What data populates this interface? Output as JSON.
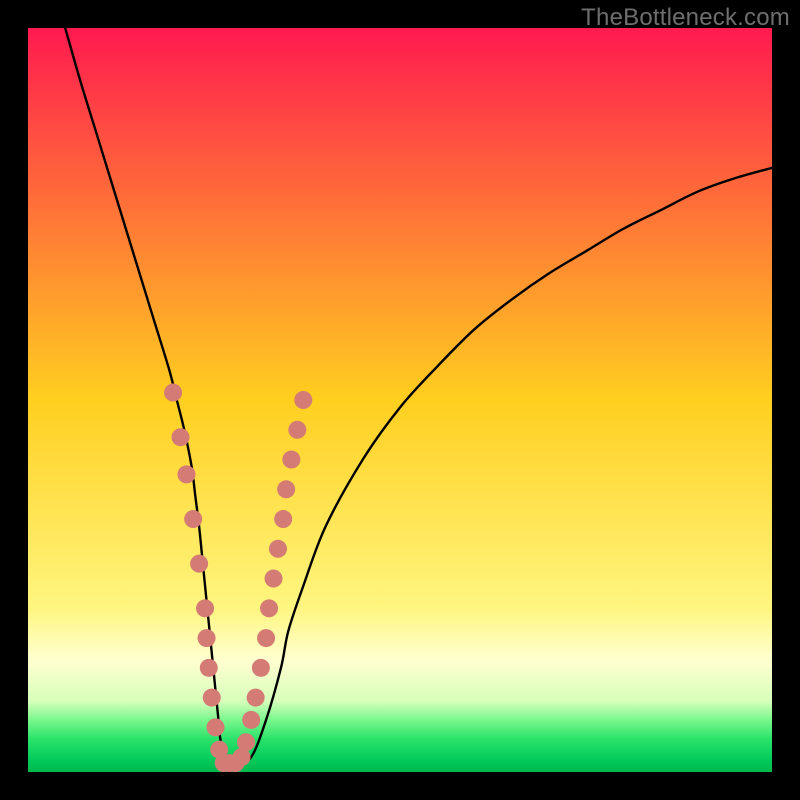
{
  "watermark": "TheBottleneck.com",
  "chart_data": {
    "type": "line",
    "title": "",
    "xlabel": "",
    "ylabel": "",
    "xlim": [
      0,
      100
    ],
    "ylim": [
      0,
      100
    ],
    "grid": false,
    "legend": false,
    "background_gradient": {
      "stops": [
        {
          "offset": 0.0,
          "color": "#ff1a4f"
        },
        {
          "offset": 0.5,
          "color": "#ffcf1f"
        },
        {
          "offset": 0.78,
          "color": "#fff680"
        },
        {
          "offset": 0.85,
          "color": "#ffffd0"
        },
        {
          "offset": 0.905,
          "color": "#d6ffba"
        },
        {
          "offset": 0.93,
          "color": "#7af78d"
        },
        {
          "offset": 0.955,
          "color": "#2ce36a"
        },
        {
          "offset": 0.985,
          "color": "#00c95a"
        },
        {
          "offset": 1.0,
          "color": "#00b84e"
        }
      ]
    },
    "series": [
      {
        "name": "bottleneck-curve",
        "x": [
          5,
          7,
          9,
          11,
          13,
          15,
          17,
          19,
          20,
          21,
          22,
          22.5,
          23,
          23.5,
          24,
          24.5,
          25,
          25.5,
          26,
          27,
          28,
          30,
          32,
          34,
          35,
          37,
          40,
          45,
          50,
          55,
          60,
          65,
          70,
          75,
          80,
          85,
          90,
          95,
          100
        ],
        "y": [
          100,
          93,
          86.5,
          80,
          73.5,
          67,
          60.5,
          54,
          50,
          46,
          41,
          37,
          33,
          28,
          23,
          18,
          13,
          8,
          3.5,
          1.2,
          1.2,
          2,
          7,
          14,
          19,
          25,
          33,
          42,
          49,
          54.5,
          59.5,
          63.5,
          67,
          70,
          73,
          75.5,
          78,
          79.8,
          81.2
        ]
      }
    ],
    "markers": {
      "name": "highlight-dots",
      "color": "#d57b76",
      "radius_px": 9,
      "points": [
        {
          "x": 19.5,
          "y": 51
        },
        {
          "x": 20.5,
          "y": 45
        },
        {
          "x": 21.3,
          "y": 40
        },
        {
          "x": 22.2,
          "y": 34
        },
        {
          "x": 23.0,
          "y": 28
        },
        {
          "x": 23.8,
          "y": 22
        },
        {
          "x": 24.0,
          "y": 18
        },
        {
          "x": 24.3,
          "y": 14
        },
        {
          "x": 24.7,
          "y": 10
        },
        {
          "x": 25.2,
          "y": 6
        },
        {
          "x": 25.7,
          "y": 3
        },
        {
          "x": 26.3,
          "y": 1.2
        },
        {
          "x": 27.1,
          "y": 1.2
        },
        {
          "x": 27.9,
          "y": 1.2
        },
        {
          "x": 28.7,
          "y": 2
        },
        {
          "x": 29.3,
          "y": 4
        },
        {
          "x": 30.0,
          "y": 7
        },
        {
          "x": 30.6,
          "y": 10
        },
        {
          "x": 31.3,
          "y": 14
        },
        {
          "x": 32.0,
          "y": 18
        },
        {
          "x": 32.4,
          "y": 22
        },
        {
          "x": 33.0,
          "y": 26
        },
        {
          "x": 33.6,
          "y": 30
        },
        {
          "x": 34.3,
          "y": 34
        },
        {
          "x": 34.7,
          "y": 38
        },
        {
          "x": 35.4,
          "y": 42
        },
        {
          "x": 36.2,
          "y": 46
        },
        {
          "x": 37.0,
          "y": 50
        }
      ]
    }
  }
}
